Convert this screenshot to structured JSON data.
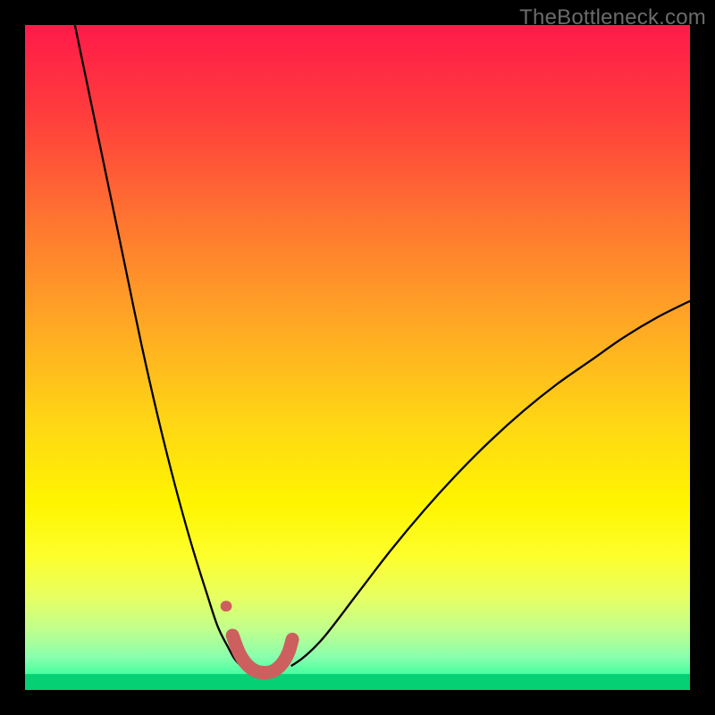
{
  "watermark": "TheBottleneck.com",
  "chart_data": {
    "type": "line",
    "title": "",
    "xlabel": "",
    "ylabel": "",
    "xlim": [
      0,
      100
    ],
    "ylim": [
      0,
      100
    ],
    "gradient_stops": [
      {
        "offset": 0.0,
        "color": "#ff1a49"
      },
      {
        "offset": 0.14,
        "color": "#ff3f3c"
      },
      {
        "offset": 0.3,
        "color": "#ff7730"
      },
      {
        "offset": 0.45,
        "color": "#ffa824"
      },
      {
        "offset": 0.6,
        "color": "#ffd714"
      },
      {
        "offset": 0.72,
        "color": "#fff500"
      },
      {
        "offset": 0.8,
        "color": "#fdff2d"
      },
      {
        "offset": 0.86,
        "color": "#e7ff62"
      },
      {
        "offset": 0.91,
        "color": "#bfff8e"
      },
      {
        "offset": 0.95,
        "color": "#8affad"
      },
      {
        "offset": 0.985,
        "color": "#2fff9c"
      },
      {
        "offset": 1.0,
        "color": "#05e079"
      }
    ],
    "series": [
      {
        "name": "left-arm",
        "stroke": "#000000",
        "width": 2.3,
        "x": [
          7.5,
          10,
          12.5,
          15,
          17.5,
          20,
          22.5,
          25,
          27.5,
          29,
          30.5,
          31.5,
          32.5
        ],
        "y": [
          100,
          88,
          76,
          64,
          52,
          41,
          31,
          22,
          14,
          9.5,
          6.5,
          4.7,
          3.6
        ]
      },
      {
        "name": "right-arm",
        "stroke": "#000000",
        "width": 2.3,
        "x": [
          40,
          42,
          45,
          50,
          55,
          60,
          65,
          70,
          75,
          80,
          85,
          90,
          95,
          100
        ],
        "y": [
          3.6,
          5.0,
          8.0,
          14.5,
          21,
          27,
          32.5,
          37.5,
          42,
          46,
          49.5,
          53,
          56,
          58.5
        ]
      },
      {
        "name": "left-marker-thick",
        "stroke": "#cd5f5f",
        "width": 15,
        "cap": "round",
        "x": [
          31.2,
          32.2,
          33.3,
          34.6,
          36.0,
          37.4,
          38.6,
          39.6,
          40.2
        ],
        "y": [
          8.2,
          5.6,
          3.9,
          2.9,
          2.6,
          2.9,
          3.9,
          5.6,
          7.6
        ]
      },
      {
        "name": "left-marker-dot",
        "stroke": "#cd5f5f",
        "width": 12,
        "cap": "round",
        "x": [
          30.2,
          30.3
        ],
        "y": [
          12.6,
          12.6
        ]
      }
    ],
    "green_floor_y": 2.4
  }
}
